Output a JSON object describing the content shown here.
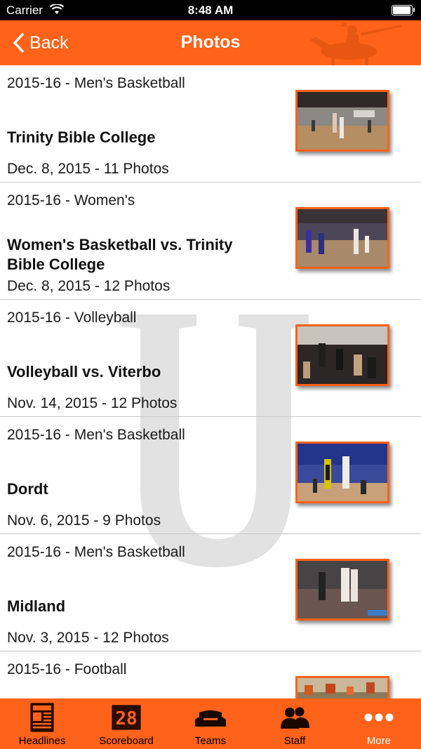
{
  "status_bar": {
    "carrier": "Carrier",
    "time": "8:48 AM",
    "battery_level": 0.95
  },
  "nav": {
    "back_label": "Back",
    "title": "Photos"
  },
  "colors": {
    "accent": "#ff6219",
    "divider": "#c8c8cc",
    "watermark": "#dddddd"
  },
  "photos": [
    {
      "category": "2015-16 - Men's Basketball",
      "title": "Trinity Bible College",
      "date": "Dec. 8, 2015 - 11 Photos"
    },
    {
      "category": "2015-16 - Women's",
      "title": "Women's Basketball vs. Trinity Bible College",
      "date": "Dec. 8, 2015 - 12 Photos"
    },
    {
      "category": "2015-16 - Volleyball",
      "title": "Volleyball vs. Viterbo",
      "date": "Nov. 14, 2015 - 12 Photos"
    },
    {
      "category": "2015-16 - Men's Basketball",
      "title": "Dordt",
      "date": "Nov. 6, 2015 - 9 Photos"
    },
    {
      "category": "2015-16 - Men's Basketball",
      "title": "Midland",
      "date": "Nov. 3, 2015 - 12 Photos"
    },
    {
      "category": "2015-16 - Football",
      "title": "",
      "date": ""
    }
  ],
  "tabs": [
    {
      "label": "Headlines",
      "icon": "newspaper-icon"
    },
    {
      "label": "Scoreboard",
      "icon": "scoreboard-icon"
    },
    {
      "label": "Teams",
      "icon": "stadium-icon"
    },
    {
      "label": "Staff",
      "icon": "people-icon"
    },
    {
      "label": "More",
      "icon": "more-dots-icon",
      "active": true
    }
  ]
}
